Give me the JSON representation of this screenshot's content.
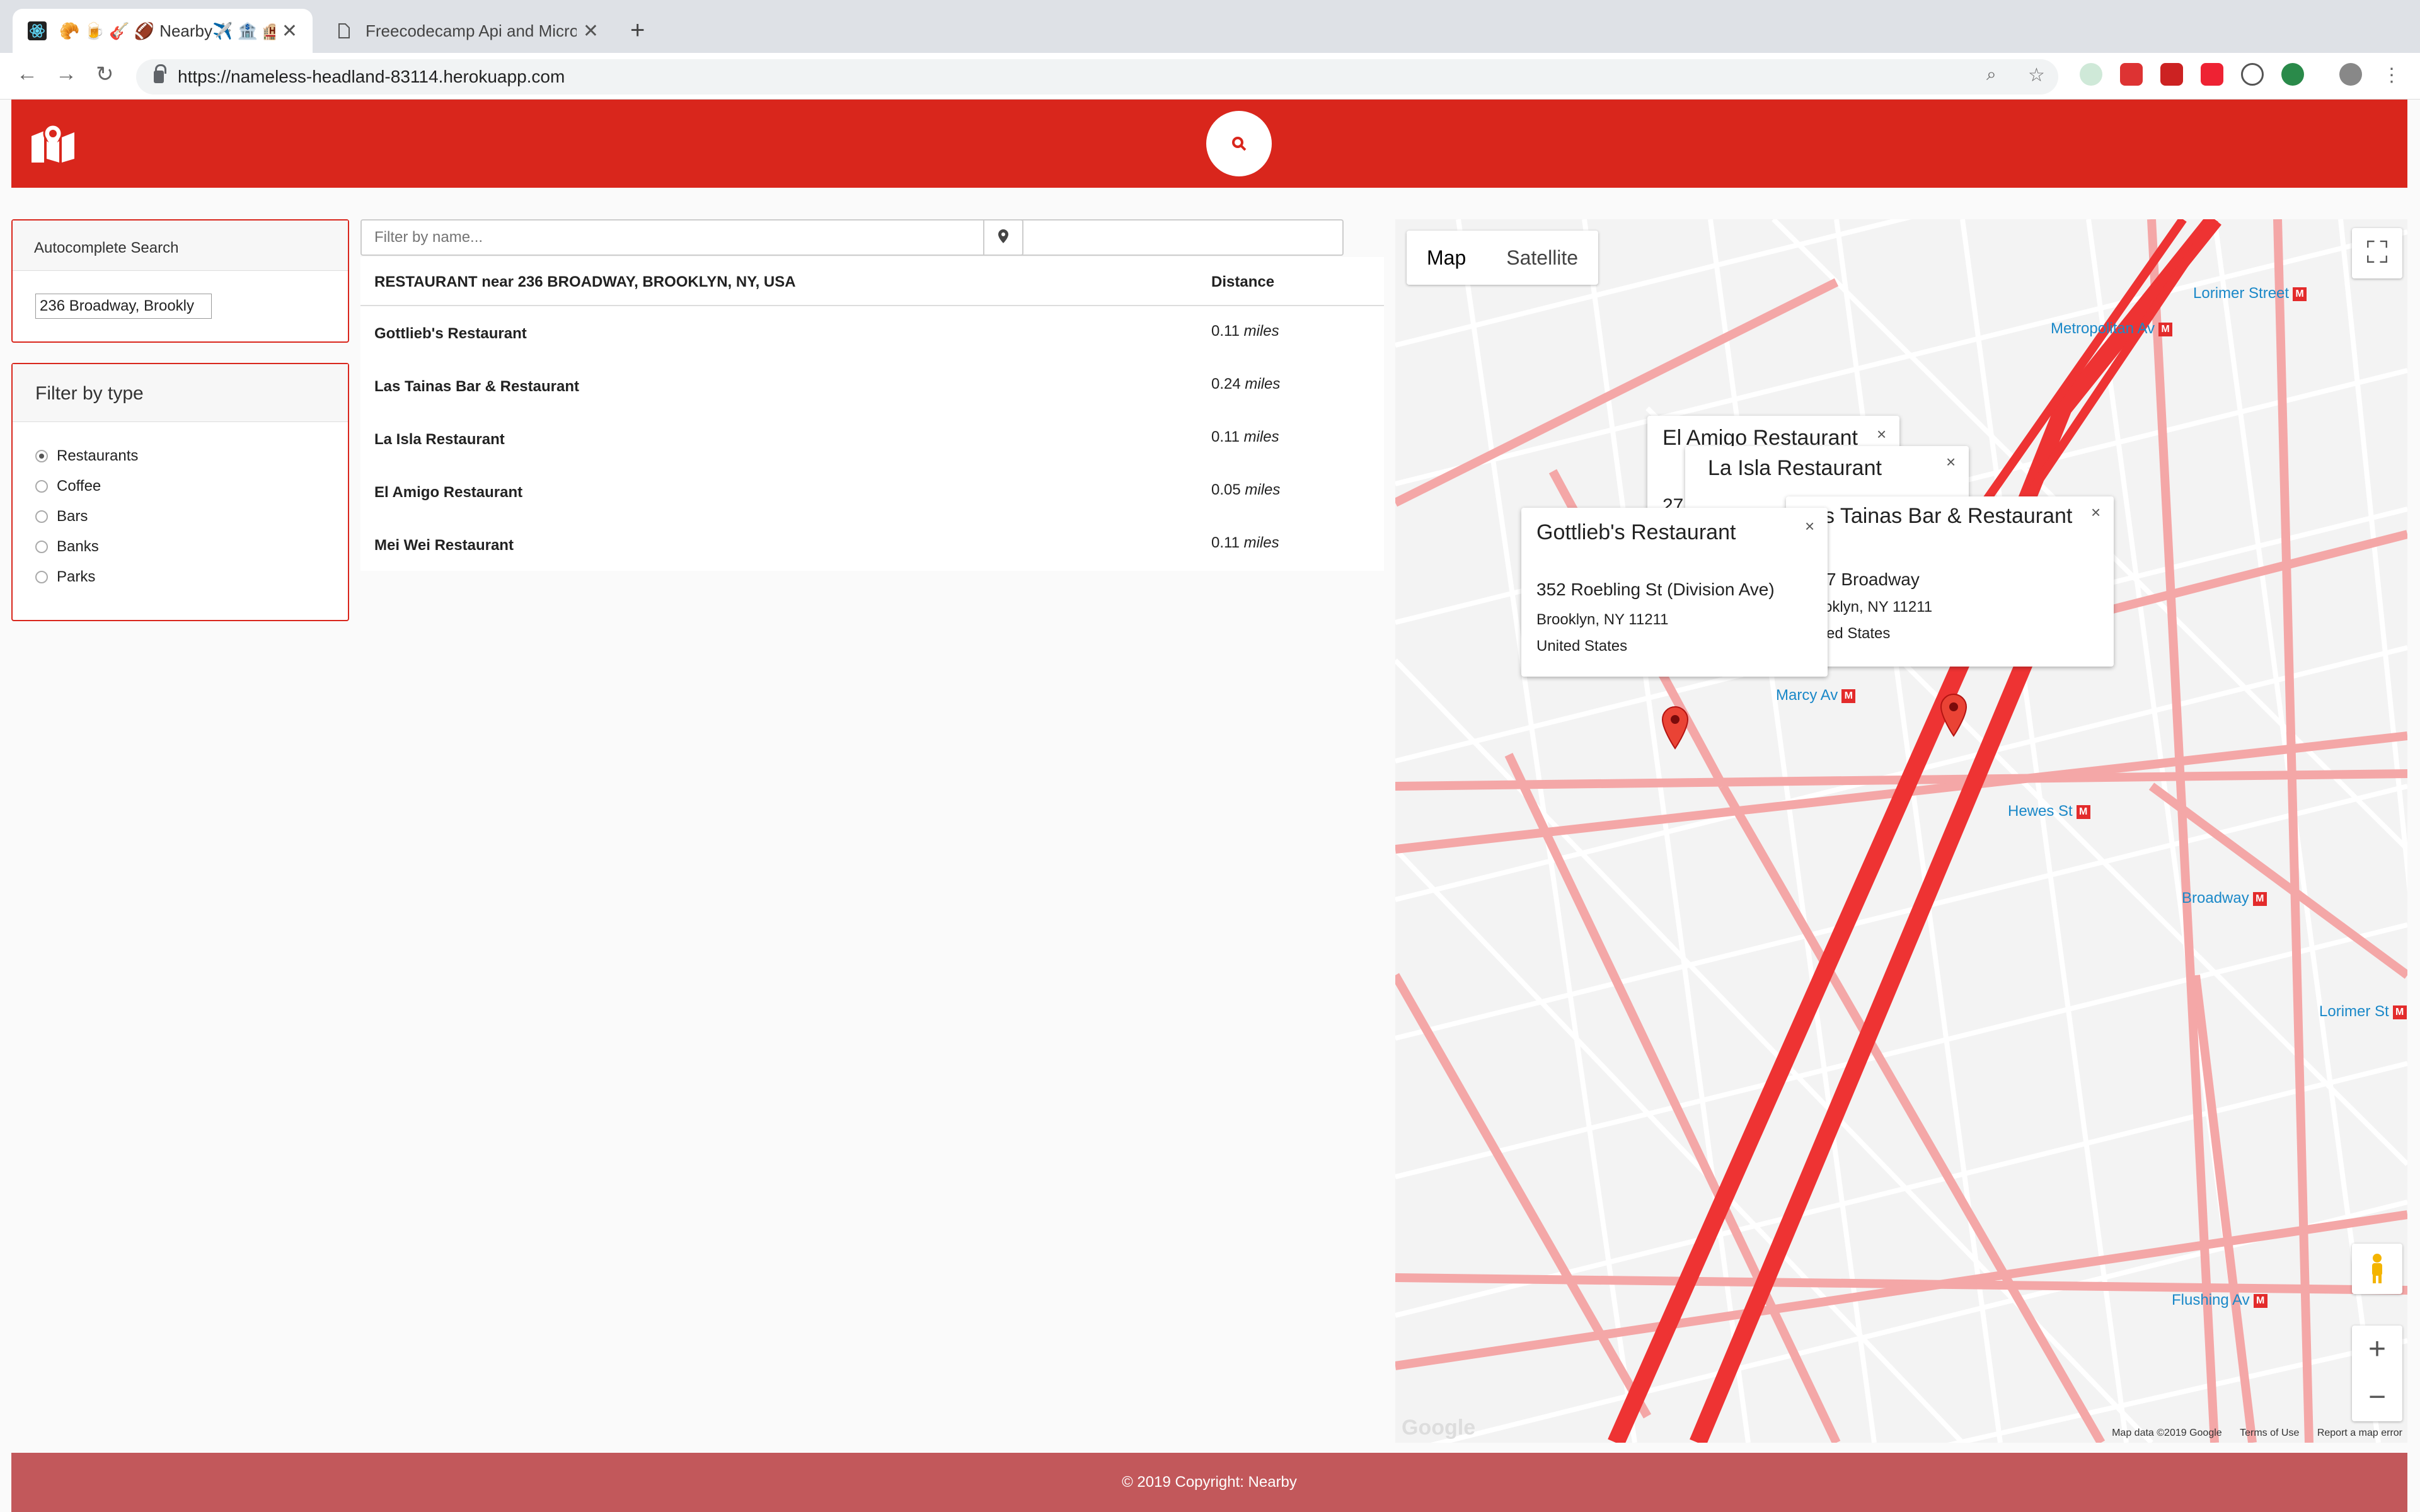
{
  "browser": {
    "tabs": [
      {
        "title": "Nearby✈️ 🏦 🏨 🏫",
        "favicon_emojis": "🥐 🍺 🎸 🏈"
      },
      {
        "title": "Freecodecamp Api and Micros"
      }
    ],
    "url": "https://nameless-headland-83114.herokuapp.com"
  },
  "sidebar": {
    "autocomplete_title": "Autocomplete Search",
    "autocomplete_value": "236 Broadway, Brookly",
    "filter_title": "Filter by type",
    "types": [
      {
        "label": "Restaurants",
        "selected": true
      },
      {
        "label": "Coffee",
        "selected": false
      },
      {
        "label": "Bars",
        "selected": false
      },
      {
        "label": "Banks",
        "selected": false
      },
      {
        "label": "Parks",
        "selected": false
      }
    ]
  },
  "results": {
    "filter_placeholder": "Filter by name...",
    "heading": "RESTAURANT near 236 BROADWAY, BROOKLYN, NY, USA",
    "distance_header": "Distance",
    "unit": "miles",
    "rows": [
      {
        "name": "Gottlieb's Restaurant",
        "distance": "0.11"
      },
      {
        "name": "Las Tainas Bar & Restaurant",
        "distance": "0.24"
      },
      {
        "name": "La Isla Restaurant",
        "distance": "0.11"
      },
      {
        "name": "El Amigo Restaurant",
        "distance": "0.05"
      },
      {
        "name": "Mei Wei Restaurant",
        "distance": "0.11"
      }
    ]
  },
  "map": {
    "toggle": [
      "Map",
      "Satellite"
    ],
    "infowindows": {
      "el_amigo": {
        "title": "El Amigo Restaurant",
        "frag": "27"
      },
      "la_isla": {
        "title": "La Isla Restaurant"
      },
      "las_tainas": {
        "title": "s Tainas Bar & Restaurant",
        "line1": "7 Broadway",
        "line2": "oklyn, NY 11211",
        "line3": "ed States"
      },
      "gottlieb": {
        "title": "Gottlieb's Restaurant",
        "line1": "352 Roebling St (Division Ave)",
        "line2": "Brooklyn, NY 11211",
        "line3": "United States"
      }
    },
    "close_glyph": "×",
    "stations": [
      "Lorimer Street",
      "Metropolitan Av",
      "Marcy Av",
      "Hewes St",
      "Broadway",
      "Lorimer St",
      "Flushing Av"
    ],
    "metro_glyph": "M",
    "zoom_in": "+",
    "zoom_out": "−",
    "attribution": {
      "data": "Map data ©2019 Google",
      "terms": "Terms of Use",
      "report": "Report a map error"
    },
    "logo": "Google",
    "colors": {
      "road": "#f4a7a7",
      "highway": "#ee3333",
      "base": "#f3f3f3"
    }
  },
  "footer": {
    "copyright": "© 2019 Copyright: Nearby"
  },
  "colors": {
    "primary": "#d9261c",
    "footer": "#c2585b"
  }
}
